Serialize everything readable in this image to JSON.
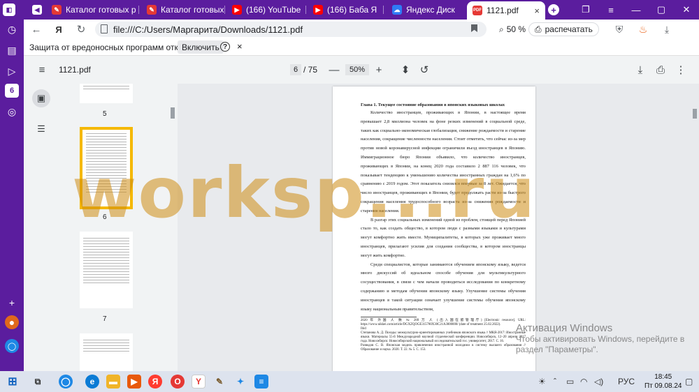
{
  "tabs": [
    {
      "label": "Каталог готовых р",
      "icon": "catalog-favicon-icon"
    },
    {
      "label": "Каталог готовых р",
      "icon": "catalog-favicon-icon"
    },
    {
      "label": "(166) YouTube",
      "icon": "youtube-icon"
    },
    {
      "label": "(166) Баба Я",
      "icon": "youtube-icon"
    },
    {
      "label": "Яндекс Диск",
      "icon": "yandex-disk-icon"
    },
    {
      "label": "1121.pdf",
      "icon": "pdf-icon",
      "active": true
    }
  ],
  "address_bar": {
    "url": "file:///C:/Users/Маргарита/Downloads/1121.pdf",
    "zoom_label": "50 %",
    "print_label": "распечатать"
  },
  "infobar": {
    "text": "Защита от вредоносных программ отключена",
    "button_label": "Включить",
    "help_symbol": "?",
    "close_symbol": "×"
  },
  "pdf_toolbar": {
    "file_name": "1121.pdf",
    "current_page": "6",
    "page_total": "/ 75",
    "zoom": "50%",
    "minus": "—",
    "plus": "+"
  },
  "thumbnails": [
    {
      "number": "5"
    },
    {
      "number": "6",
      "selected": true
    },
    {
      "number": "7"
    }
  ],
  "document": {
    "heading": "Глава 1. Текущее состояние образования в японских языковых школах",
    "para1": "Количество иностранцев, проживающих в Японии, в настоящее время превышает 2,8 миллиона человек на фоне резких изменений в социальной среде, таких как социально-экономическая глобализация, снижение рождаемости и старение населения, сокращение численности населения. Стоит отметить, что сейчас из-за мер против новой коронавирусной инфекции ограничили въезд иностранцев в Японию. Иммиграционное бюро Японии объявило, что количество иностранцев, проживающих в Японии, на конец 2020 года составило 2 887 116 человек, что показывает тенденцию к уменьшению количества иностранных граждан на 1,6% по сравнению с 2019 годом. Этот показатель снизился впервые за 8 лет. Ожидается, что число иностранцев, проживающих в Японии, будет продолжать расти из-за быстрого сокращения населения трудоспособного возраста из-за снижения рождаемости и старения населения.",
    "para2": "В разгар этих социальных изменений одной из проблем, стоящей перед Японией стало то, как создать общество, в котором люди с разными языками и культурами могут комфортно жить вместе. Муниципалитеты, в которых уже проживает много иностранцев, прилагают усилия для создания сообщества, в котором иностранцы могут жить комфортно.",
    "para3": "Среди специалистов, которые занимаются обучением японскому языку, ведется много дискуссий об идеальном способе обучения для мультикультурного сосуществования, в связи с чем начали проводиться исследования по конкретному содержанию и методам обучения японскому языку. Улучшение системы обучения иностранцев в такой ситуации означает улучшение системы обучения японскому языку национальным правительством,",
    "footnote1": "2020 年 外国 人 数 № 288 万 人 (出入国在留管理庁) [Electronic resource]. URL: https://www.nikkei.com/article/DGXZQOGE315780X30C21A3000000/ (date of treatment 25.02.2022).",
    "footnote2": "Ibid",
    "footnote3": "Степанова А. Д. Походы: межкультурно-ориентированных учебников японского языка // МКЯ-2017: Иностранные языки. Материалы 55-й Международной научной студенческой конференции. Новосибирск, 12–20 апреля 2017 года. Новосибирск: Новосибирский национальный исследовательский гос. университет, 2017. С. 16.",
    "footnote4": "Разводов С. В. Японская модель привлечения иностранной молодежи в систему высшего образования // Образование и наука. 2020. Т. 22. № 5. С. 153.",
    "page_number": "6"
  },
  "watermark": "worksp...ru",
  "activation": {
    "title": "Активация Windows",
    "subtitle": "Чтобы активировать Windows, перейдите в раздел \"Параметры\"."
  },
  "taskbar": {
    "lang": "РУС",
    "time": "18:45",
    "date": "Пт 09.08.24"
  }
}
